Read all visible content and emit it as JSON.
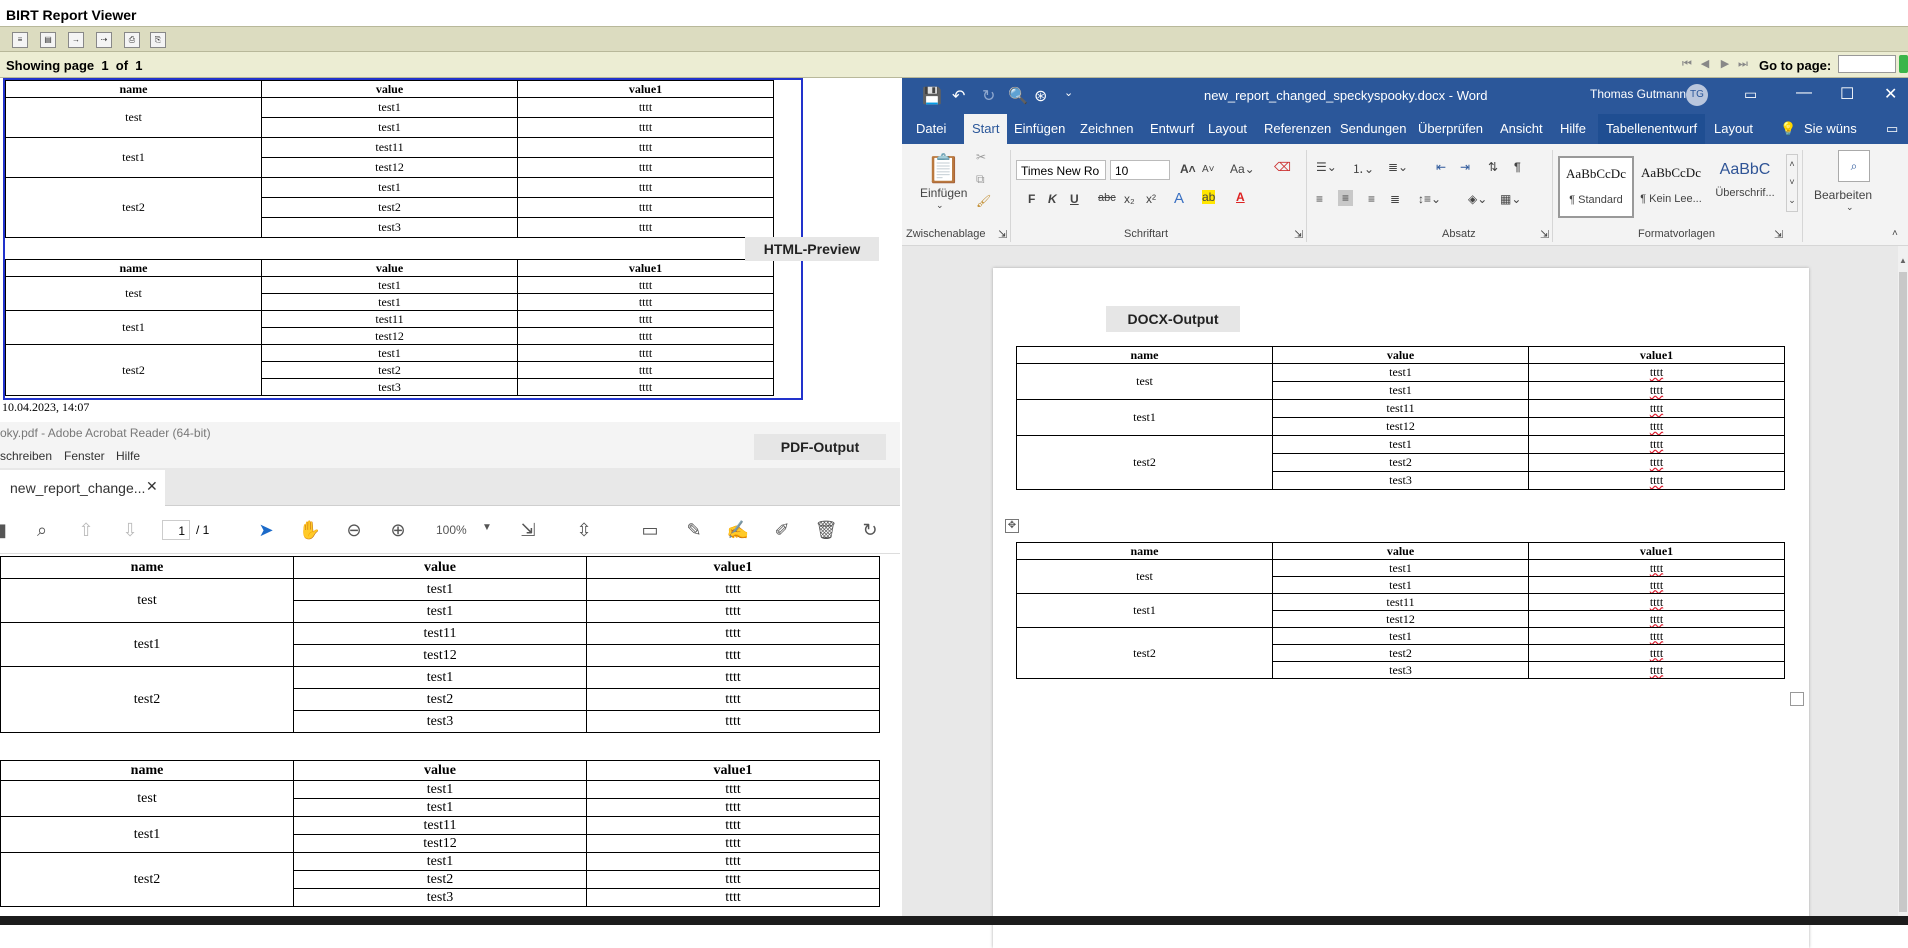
{
  "birt": {
    "title": "BIRT Report Viewer",
    "toolbar_icons": [
      "toc-icon",
      "parameters-icon",
      "export-data-icon",
      "export-report-icon",
      "print-icon",
      "print-server-icon"
    ],
    "nav": {
      "showing": "Showing page  1  of  1",
      "goto_label": "Go to page:",
      "goto_value": ""
    },
    "html_label": "HTML-Preview",
    "timestamp": "10.04.2023, 14:07"
  },
  "report": {
    "headers": [
      "name",
      "value",
      "value1"
    ],
    "groups": [
      {
        "name": "test",
        "rows": [
          [
            "test1",
            "tttt"
          ],
          [
            "test1",
            "tttt"
          ]
        ]
      },
      {
        "name": "test1",
        "rows": [
          [
            "test11",
            "tttt"
          ],
          [
            "test12",
            "tttt"
          ]
        ]
      },
      {
        "name": "test2",
        "rows": [
          [
            "test1",
            "tttt"
          ],
          [
            "test2",
            "tttt"
          ],
          [
            "test3",
            "tttt"
          ]
        ]
      }
    ]
  },
  "acrobat": {
    "title": "oky.pdf - Adobe Acrobat Reader (64-bit)",
    "menu": [
      "schreiben",
      "Fenster",
      "Hilfe"
    ],
    "tab": "new_report_change...",
    "page_current": "1",
    "page_total": "/ 1",
    "zoom": "100%",
    "pdf_label": "PDF-Output"
  },
  "word": {
    "title": "new_report_changed_speckyspooky.docx  -  Word",
    "user": "Thomas Gutmann",
    "user_initials": "TG",
    "tabs": [
      "Datei",
      "Start",
      "Einfügen",
      "Zeichnen",
      "Entwurf",
      "Layout",
      "Referenzen",
      "Sendungen",
      "Überprüfen",
      "Ansicht",
      "Hilfe",
      "Tabellenentwurf",
      "Layout"
    ],
    "tell_me": "Sie wüns",
    "paste_label": "Einfügen",
    "font_name": "Times New Ro",
    "font_size": "10",
    "groups": [
      "Zwischenablage",
      "Schriftart",
      "Absatz",
      "Formatvorlagen",
      "Bearbeiten"
    ],
    "styles": [
      {
        "preview": "AaBbCcDc",
        "name": "¶ Standard"
      },
      {
        "preview": "AaBbCcDc",
        "name": "¶ Kein Lee..."
      },
      {
        "preview": "AaBbC",
        "name": "Überschrif..."
      }
    ],
    "docx_label": "DOCX-Output"
  }
}
